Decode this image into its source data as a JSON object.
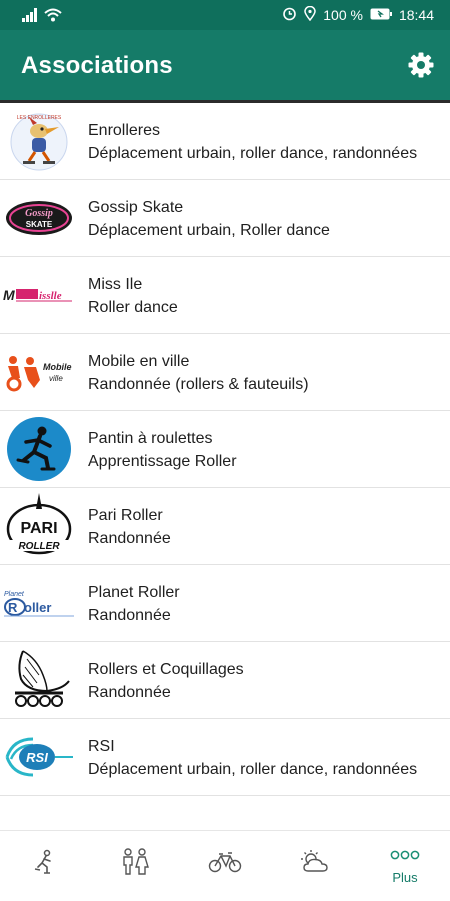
{
  "status": {
    "battery": "100 %",
    "time": "18:44"
  },
  "app": {
    "title": "Associations",
    "settings_icon": "gear-icon"
  },
  "colors": {
    "primary": "#157b68",
    "status_bar": "#0f6f5c",
    "accent": "#1b8f74"
  },
  "associations": [
    {
      "name": "Enrolleres",
      "desc": "Déplacement urbain, roller dance, randonnées",
      "logo": "enrolleres-logo",
      "logo_text": "LES ENROLLERES"
    },
    {
      "name": "Gossip Skate",
      "desc": "Déplacement urbain, Roller dance",
      "logo": "gossip-skate-logo",
      "logo_text": "Gossip Skate"
    },
    {
      "name": "Miss Ile",
      "desc": "Roller dance",
      "logo": "miss-ile-logo",
      "logo_text": "MissIle"
    },
    {
      "name": "Mobile en ville",
      "desc": "Randonnée (rollers & fauteuils)",
      "logo": "mobile-en-ville-logo",
      "logo_text": "Mobile en ville"
    },
    {
      "name": "Pantin à roulettes",
      "desc": "Apprentissage Roller",
      "logo": "pantin-logo",
      "logo_text": ""
    },
    {
      "name": "Pari Roller",
      "desc": "Randonnée",
      "logo": "pari-roller-logo",
      "logo_text": "PARI ROLLER"
    },
    {
      "name": "Planet Roller",
      "desc": "Randonnée",
      "logo": "planet-roller-logo",
      "logo_text": "Planet Roller"
    },
    {
      "name": "Rollers et Coquillages",
      "desc": "Randonnée",
      "logo": "rollers-coquillages-logo",
      "logo_text": ""
    },
    {
      "name": "RSI",
      "desc": "Déplacement urbain, roller dance, randonnées",
      "logo": "rsi-logo",
      "logo_text": "RSI"
    }
  ],
  "nav": [
    {
      "icon": "skater-icon",
      "label": ""
    },
    {
      "icon": "people-icon",
      "label": ""
    },
    {
      "icon": "bikes-icon",
      "label": ""
    },
    {
      "icon": "weather-icon",
      "label": ""
    },
    {
      "icon": "more-icon",
      "label": "Plus"
    }
  ]
}
